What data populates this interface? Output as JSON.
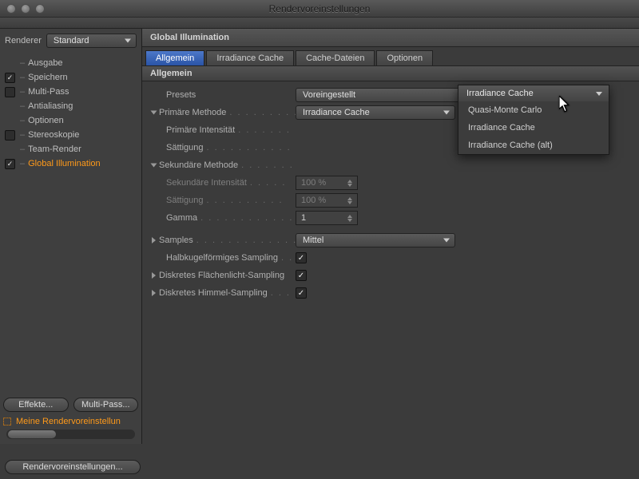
{
  "window": {
    "title": "Rendervoreinstellungen"
  },
  "left": {
    "renderer_label": "Renderer",
    "renderer_value": "Standard",
    "tree": [
      {
        "label": "Ausgabe",
        "checkbox": false
      },
      {
        "label": "Speichern",
        "checkbox": true,
        "checked": true
      },
      {
        "label": "Multi-Pass",
        "checkbox": true,
        "checked": false
      },
      {
        "label": "Antialiasing",
        "checkbox": false
      },
      {
        "label": "Optionen",
        "checkbox": false
      },
      {
        "label": "Stereoskopie",
        "checkbox": true,
        "checked": false
      },
      {
        "label": "Team-Render",
        "checkbox": false
      },
      {
        "label": "Global Illumination",
        "checkbox": true,
        "checked": true,
        "selected": true
      }
    ],
    "buttons": {
      "effects": "Effekte...",
      "multipass": "Multi-Pass..."
    },
    "preset": {
      "label": "Meine Rendervoreinstellun"
    }
  },
  "right": {
    "header": "Global Illumination",
    "tabs": [
      "Allgemein",
      "Irradiance Cache",
      "Cache-Dateien",
      "Optionen"
    ],
    "active_tab": 0,
    "section": "Allgemein",
    "presets": {
      "label": "Presets",
      "value": "Voreingestellt"
    },
    "rows": {
      "primary_method": {
        "label": "Primäre Methode",
        "value": "Irradiance Cache"
      },
      "primary_intensity": {
        "label": "Primäre Intensität",
        "value": ""
      },
      "primary_sat": {
        "label": "Sättigung",
        "value": ""
      },
      "secondary_method": {
        "label": "Sekundäre Methode",
        "value": ""
      },
      "secondary_intensity": {
        "label": "Sekundäre Intensität",
        "value": "100 %"
      },
      "secondary_sat": {
        "label": "Sättigung",
        "value": "100 %"
      },
      "gamma": {
        "label": "Gamma",
        "value": "1"
      },
      "samples": {
        "label": "Samples",
        "value": "Mittel"
      },
      "hemi": {
        "label": "Halbkugelförmiges Sampling",
        "checked": true
      },
      "area": {
        "label": "Diskretes Flächenlicht-Sampling",
        "checked": true
      },
      "sky": {
        "label": "Diskretes Himmel-Sampling",
        "checked": true
      }
    },
    "dropdown_menu": {
      "selected": "Irradiance Cache",
      "options": [
        "Quasi-Monte Carlo",
        "Irradiance Cache",
        "Irradiance Cache (alt)"
      ]
    }
  },
  "footer": {
    "button": "Rendervoreinstellungen..."
  }
}
